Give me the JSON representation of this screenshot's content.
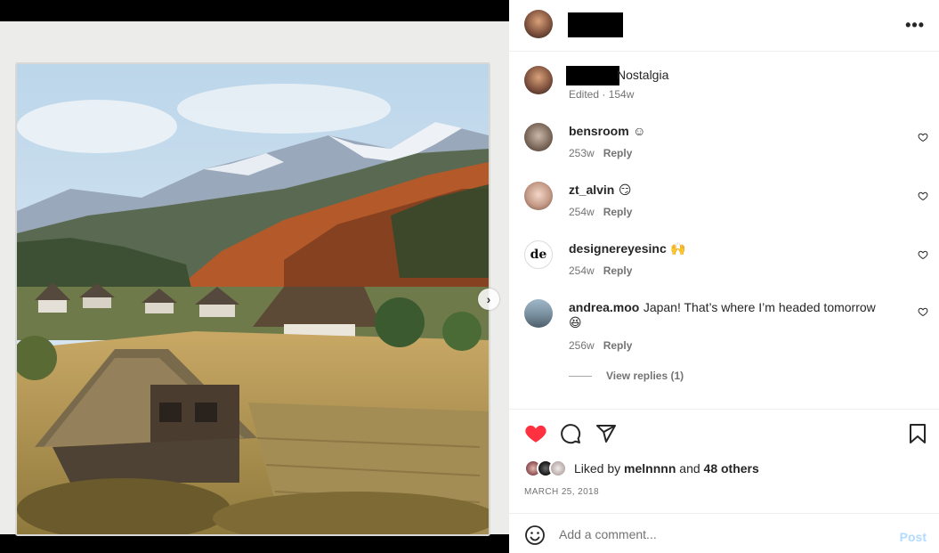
{
  "post": {
    "caption_text": "Nostalgia",
    "caption_meta": "Edited · 154w"
  },
  "comments": [
    {
      "username": "bensroom",
      "text": "☺",
      "time": "253w",
      "reply": "Reply"
    },
    {
      "username": "zt_alvin",
      "text": "😏",
      "time": "254w",
      "reply": "Reply"
    },
    {
      "username": "designereyesinc",
      "text": "🙌",
      "time": "254w",
      "reply": "Reply"
    },
    {
      "username": "andrea.moo",
      "text": "Japan! That’s where I’m headed tomorrow",
      "text2": "😆",
      "time": "256w",
      "reply": "Reply"
    }
  ],
  "view_replies": "View replies (1)",
  "likes": {
    "prefix": "Liked by ",
    "user": "melnnnn",
    "middle": " and ",
    "others": "48 others"
  },
  "date": "MARCH 25, 2018",
  "comment_box": {
    "placeholder": "Add a comment...",
    "post_label": "Post"
  },
  "colors": {
    "like_red": "#ff3040",
    "post_disabled": "#b3dbff",
    "meta_gray": "#737373"
  },
  "icons": {
    "more": "more-horizontal-icon",
    "next": "chevron-right-icon",
    "like": "heart-filled-icon",
    "comment": "comment-bubble-icon",
    "share": "paper-plane-icon",
    "save": "bookmark-icon",
    "emoji": "smiley-icon"
  }
}
